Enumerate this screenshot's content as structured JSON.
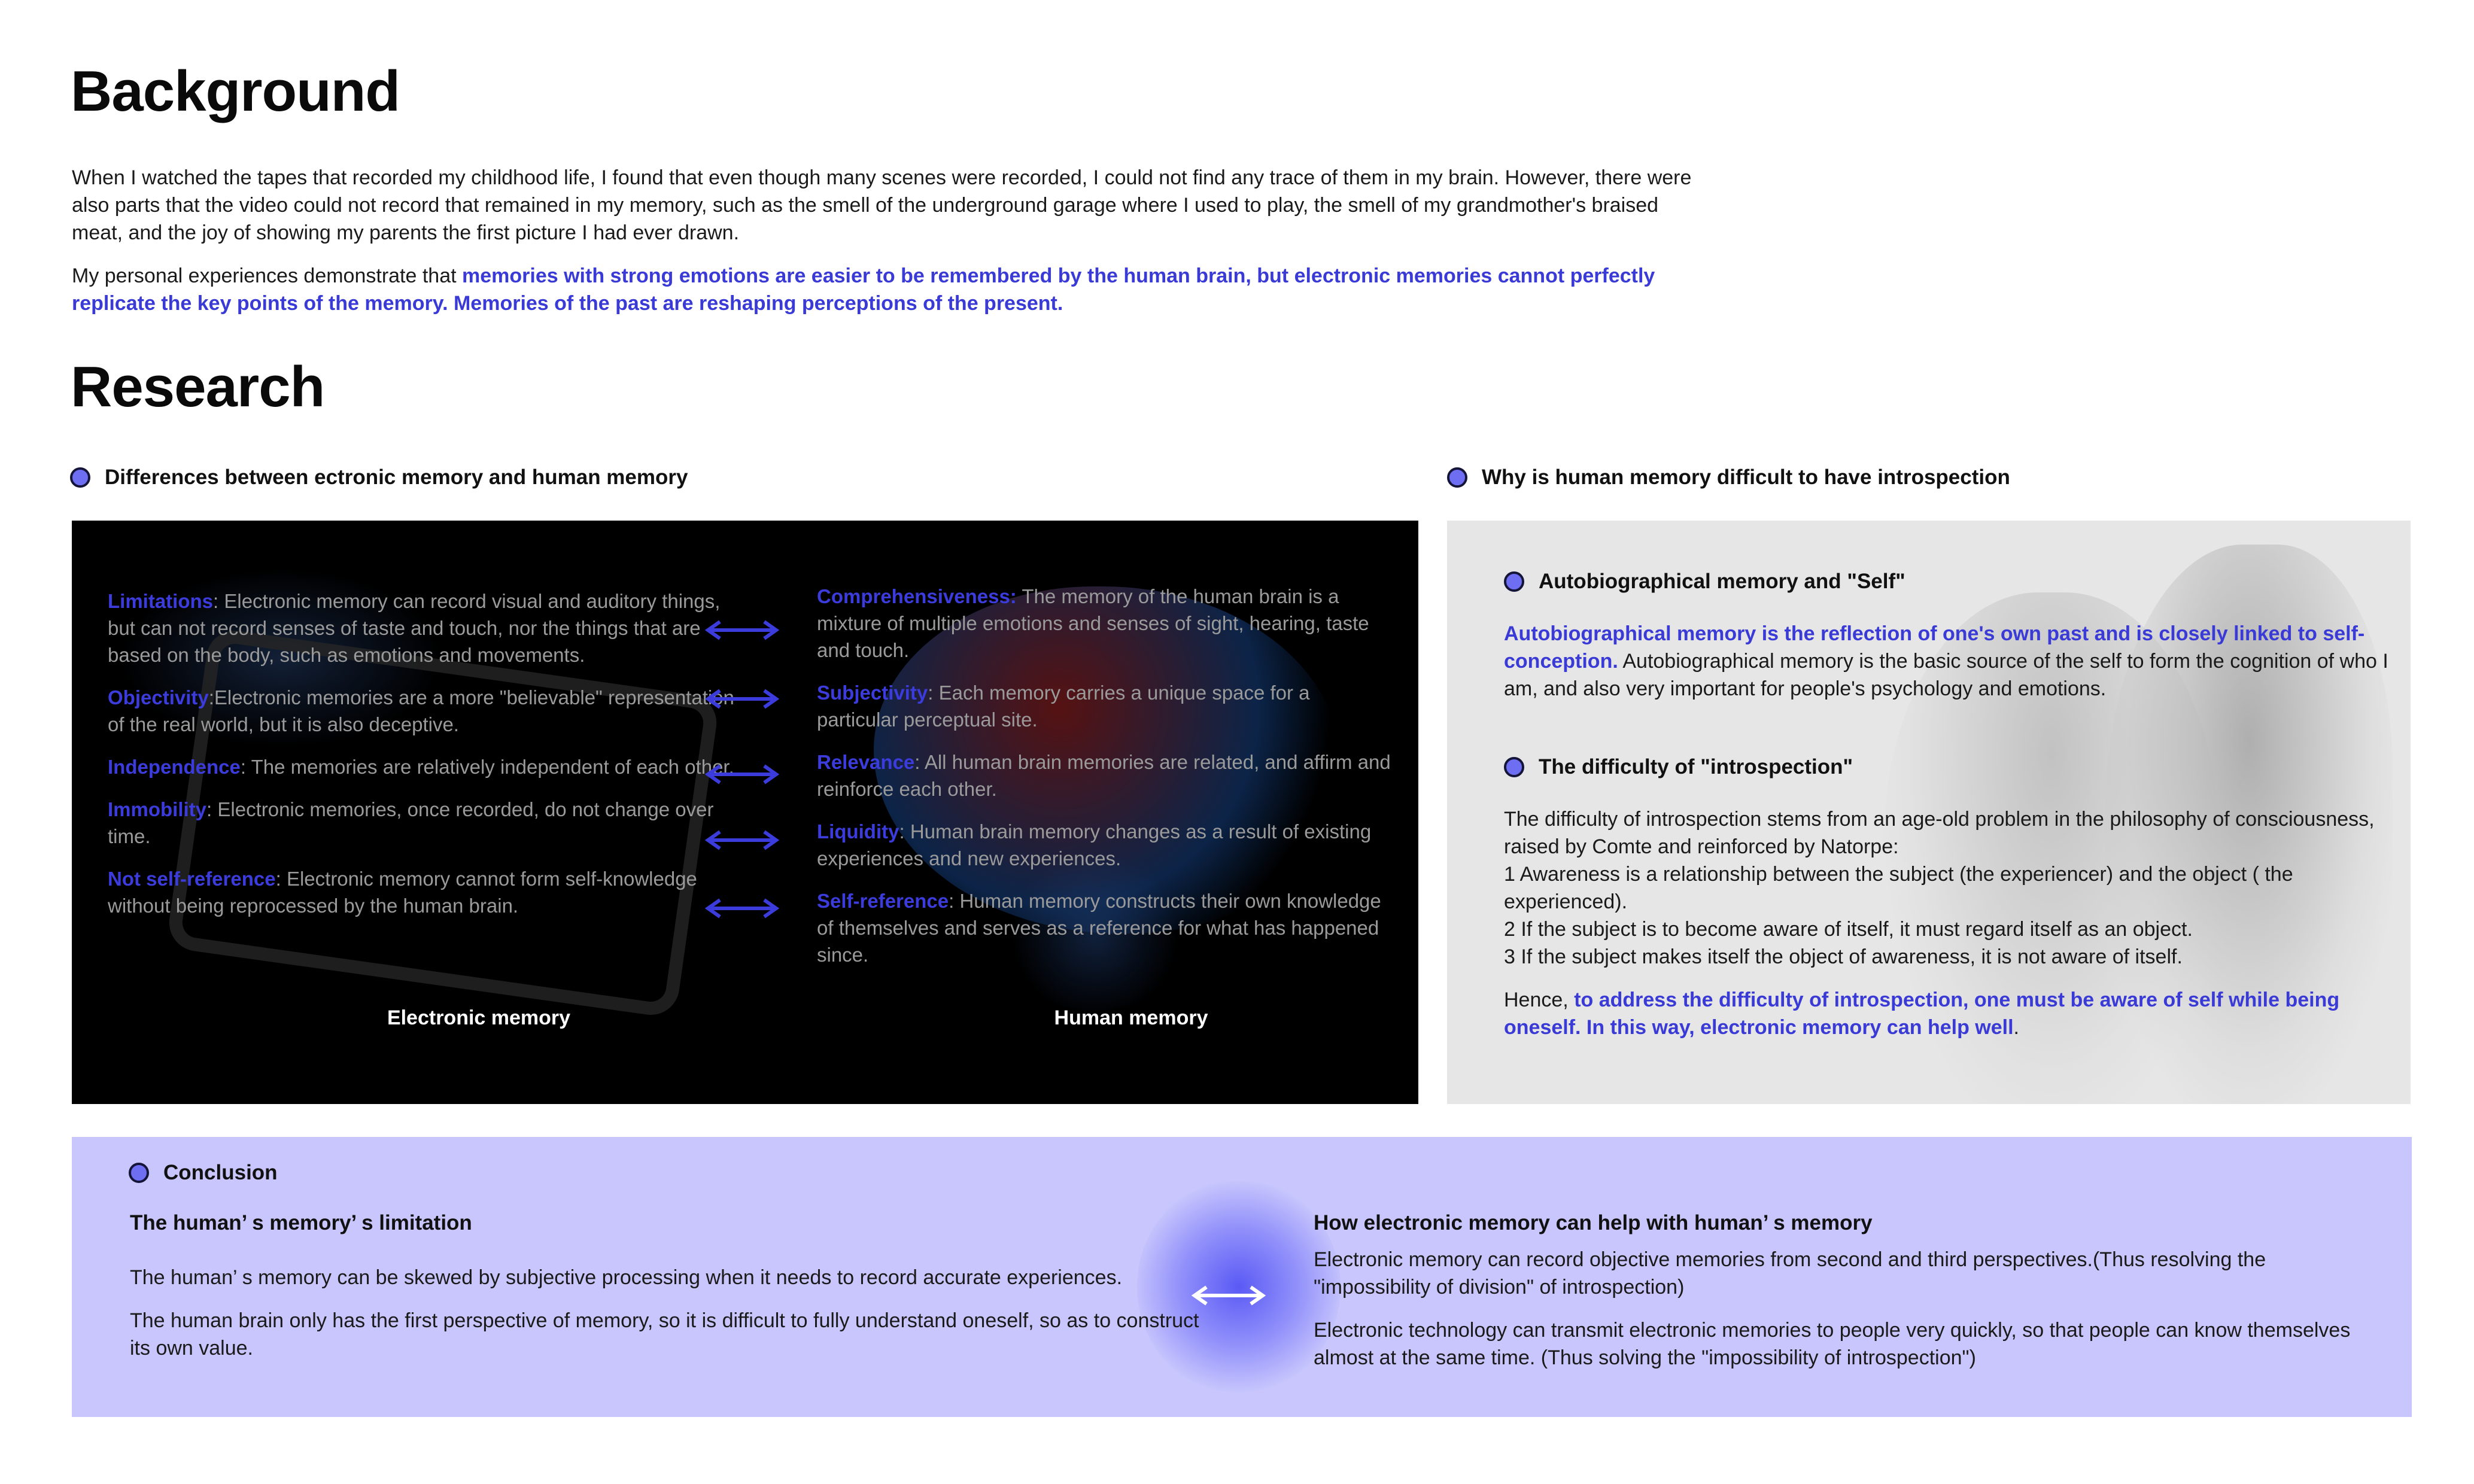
{
  "background": {
    "heading": "Background",
    "para1": "When I watched the tapes that recorded my childhood life, I found that even though many scenes were recorded, I could not find any trace of them in my brain. However, there were also parts that the video could not record that remained in my memory, such as the smell of the underground garage where I used to play, the smell of my grandmother's braised meat, and the joy of showing my parents the first picture I had ever drawn.",
    "para2_lead": "My personal experiences demonstrate that ",
    "para2_highlight": "memories with strong emotions are easier to be remembered by the human brain, but electronic memories cannot perfectly replicate the key points of the memory. Memories of the past are reshaping perceptions of the present."
  },
  "research": {
    "heading": "Research",
    "left_section_title": "Differences between ectronic memory and human memory",
    "right_section_title": "Why is human memory difficult to have introspection"
  },
  "electronic": {
    "items": [
      {
        "term": "Limitations",
        "sep": ": ",
        "text": "Electronic memory can record visual and auditory things, but can not record senses of taste and touch, nor the things that are based on the body, such as emotions and movements."
      },
      {
        "term": "Objectivity",
        "sep": ":",
        "text": "Electronic memories are a more \"believable\" representation of the real world, but it is also deceptive."
      },
      {
        "term": "Independence",
        "sep": ": ",
        "text": "The memories are relatively independent of each other."
      },
      {
        "term": "Immobility",
        "sep": ": ",
        "text": "Electronic memories, once recorded, do not change over time."
      },
      {
        "term": "Not self-reference",
        "sep": ": ",
        "text": "Electronic memory cannot form self-knowledge without being reprocessed by the human brain."
      }
    ],
    "label": "Electronic memory"
  },
  "human": {
    "items": [
      {
        "term": " Comprehensiveness:",
        "sep": " ",
        "text": "The memory of the human brain is a mixture of multiple emotions and senses of sight, hearing, taste and touch."
      },
      {
        "term": "Subjectivity",
        "sep": ": ",
        "text": "Each memory carries a unique space for a particular perceptual site."
      },
      {
        "term": "Relevance",
        "sep": ": ",
        "text": "All human brain memories are related, and affirm and reinforce each other."
      },
      {
        "term": "Liquidity",
        "sep": ": ",
        "text": "Human brain memory changes as a result of existing experiences and new experiences."
      },
      {
        "term": "Self-reference",
        "sep": ": ",
        "text": "Human memory constructs their own knowledge of themselves and serves as a reference for what has happened since."
      }
    ],
    "label": "Human memory"
  },
  "introspection": {
    "auto_title": "Autobiographical memory and \"Self\"",
    "auto_highlight": "Autobiographical memory is the reflection of one's own past and is closely linked to self-conception.",
    "auto_text": " Autobiographical memory is the basic source of the self to form the cognition of who I am, and also very important for people's psychology and emotions.",
    "diff_title": "The difficulty of \"introspection\"",
    "diff_intro": "The difficulty of introspection stems from an age-old problem in the philosophy of consciousness, raised by Comte and reinforced by Natorpe:",
    "diff_1": "1 Awareness is a relationship between the subject (the experiencer) and the object ( the experienced).",
    "diff_2": "2 If the subject is to become aware of itself, it must regard itself as an object.",
    "diff_3": "3 If the subject makes itself the object of awareness, it is not aware of itself.",
    "hence_lead": "Hence, ",
    "hence_highlight": "to address the difficulty of introspection, one must be aware of self while being oneself. In this way, electronic memory can help well",
    "hence_end": "."
  },
  "conclusion": {
    "title": "Conclusion",
    "left_title": "The human’ s memory’ s limitation",
    "left_p1": "The human’ s memory can be skewed by subjective processing when it needs to record accurate experiences.",
    "left_p2": "The human brain only has the first perspective of memory, so it is difficult to fully understand oneself, so as to construct its own value.",
    "right_title": "How electronic memory can help with human’ s memory",
    "right_p1": "Electronic memory can record objective memories from second and third perspectives.(Thus resolving the \"impossibility of division\" of introspection)",
    "right_p2": "Electronic technology can transmit electronic memories to people very quickly, so that people can know themselves almost at the same time. (Thus solving the \"impossibility of introspection\")"
  },
  "colors": {
    "accent": "#3a3ad6",
    "dot": "#6e6ef2",
    "conclusion_bg": "#c8c6fc"
  }
}
